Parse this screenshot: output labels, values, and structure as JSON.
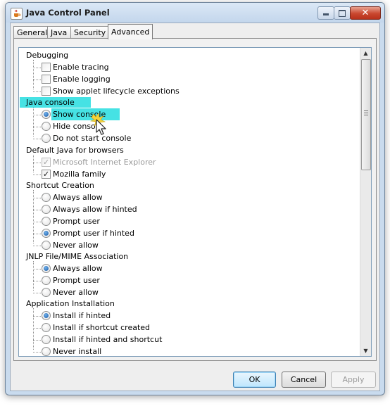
{
  "window": {
    "title": "Java Control Panel"
  },
  "tabs": [
    {
      "label": "General"
    },
    {
      "label": "Java"
    },
    {
      "label": "Security"
    },
    {
      "label": "Advanced",
      "active": true
    }
  ],
  "tree": {
    "debugging": {
      "label": "Debugging",
      "items": [
        {
          "label": "Enable tracing",
          "checked": false
        },
        {
          "label": "Enable logging",
          "checked": false
        },
        {
          "label": "Show applet lifecycle exceptions",
          "checked": false
        }
      ]
    },
    "java_console": {
      "label": "Java console",
      "items": [
        {
          "label": "Show console",
          "selected": true
        },
        {
          "label": "Hide console",
          "selected": false
        },
        {
          "label": "Do not start console",
          "selected": false
        }
      ]
    },
    "default_browsers": {
      "label": "Default Java for browsers",
      "items": [
        {
          "label": "Microsoft Internet Explorer",
          "checked": true,
          "disabled": true
        },
        {
          "label": "Mozilla family",
          "checked": true
        }
      ]
    },
    "shortcut_creation": {
      "label": "Shortcut Creation",
      "items": [
        {
          "label": "Always allow",
          "selected": false
        },
        {
          "label": "Always allow if hinted",
          "selected": false
        },
        {
          "label": "Prompt user",
          "selected": false
        },
        {
          "label": "Prompt user if hinted",
          "selected": true
        },
        {
          "label": "Never allow",
          "selected": false
        }
      ]
    },
    "jnlp_association": {
      "label": "JNLP File/MIME Association",
      "items": [
        {
          "label": "Always allow",
          "selected": true
        },
        {
          "label": "Prompt user",
          "selected": false
        },
        {
          "label": "Never allow",
          "selected": false
        }
      ]
    },
    "app_installation": {
      "label": "Application Installation",
      "items": [
        {
          "label": "Install if hinted",
          "selected": true
        },
        {
          "label": "Install if shortcut created",
          "selected": false
        },
        {
          "label": "Install if hinted and shortcut",
          "selected": false
        },
        {
          "label": "Never install",
          "selected": false
        }
      ]
    }
  },
  "buttons": {
    "ok": "OK",
    "cancel": "Cancel",
    "apply": "Apply"
  },
  "colors": {
    "highlight": "#46e2e4",
    "accent": "#1b5aa6"
  }
}
